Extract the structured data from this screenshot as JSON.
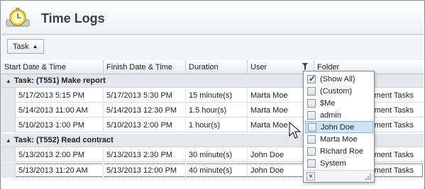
{
  "header": {
    "title": "Time Logs",
    "icon": "clock-icon"
  },
  "groupbar": {
    "group_label": "Task"
  },
  "columns": [
    {
      "label": "Start Date & Time"
    },
    {
      "label": "Finish Date & Time"
    },
    {
      "label": "Duration"
    },
    {
      "label": "User"
    },
    {
      "label": "Folder"
    }
  ],
  "groups": [
    {
      "label": "Task: (T551) Make report",
      "rows": [
        {
          "start": "5/17/2013 5:15 PM",
          "finish": "5/17/2013 5:30 PM",
          "duration": "15 minute(s)",
          "user": "Marta Moe",
          "folder": "ment Tasks"
        },
        {
          "start": "5/14/2013 11:00 AM",
          "finish": "5/14/2013 12:30 PM",
          "duration": "1.5 hour(s)",
          "user": "Marta Moe",
          "folder": "ment Tasks"
        },
        {
          "start": "5/10/2013 1:00 PM",
          "finish": "5/10/2013 2:00 PM",
          "duration": "1 hour(s)",
          "user": "Marta Moe",
          "folder": "ment Tasks"
        }
      ]
    },
    {
      "label": "Task: (T552) Read contract",
      "rows": [
        {
          "start": "5/13/2013 2:00 PM",
          "finish": "5/13/2013 2:30 PM",
          "duration": "30 minute(s)",
          "user": "John Doe",
          "folder": "ment Tasks"
        },
        {
          "start": "5/13/2013 11:20 AM",
          "finish": "5/13/2013 12:00 PM",
          "duration": "40 minute(s)",
          "user": "John Doe",
          "folder": "ment Tasks"
        }
      ]
    }
  ],
  "filter_dropdown": {
    "items": [
      {
        "label": "(Show All)",
        "checked": true
      },
      {
        "label": "(Custom)",
        "checked": false
      },
      {
        "label": "$Me",
        "checked": false
      },
      {
        "label": "admin",
        "checked": false
      },
      {
        "label": "John Doe",
        "checked": false
      },
      {
        "label": "Marta Moe",
        "checked": false
      },
      {
        "label": "Richard Roe",
        "checked": false
      },
      {
        "label": "System",
        "checked": false
      }
    ],
    "highlighted": "John Doe"
  },
  "colors": {
    "accent": "#cfe3f6",
    "group_bg": "#e4e7eb",
    "header_title": "#3a3f46"
  }
}
